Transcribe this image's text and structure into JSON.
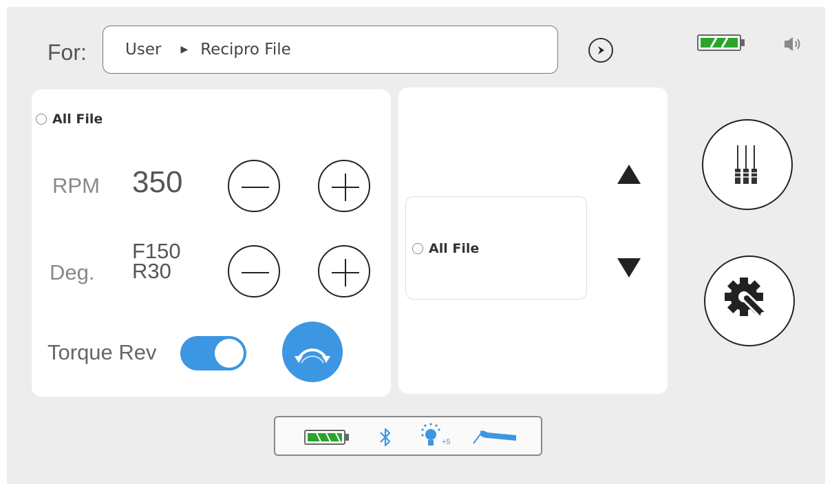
{
  "header": {
    "for_label": "For:",
    "breadcrumb": [
      "User",
      "Recipro File"
    ],
    "breadcrumb_separator": "▶"
  },
  "settings": {
    "file_option_label": "All File",
    "rpm": {
      "label": "RPM",
      "value": "350"
    },
    "degree": {
      "label": "Deg.",
      "forward": "F150",
      "reverse": "R30"
    },
    "torque_rev": {
      "label": "Torque Rev",
      "enabled": true
    }
  },
  "file_list": {
    "items": [
      {
        "label": "All File",
        "selected": false
      }
    ]
  },
  "status": {
    "light_level": "+5"
  },
  "colors": {
    "accent": "#3d96e2",
    "battery": "#2aa52a",
    "background": "#ededed"
  },
  "icons": [
    "forward-arrow-icon",
    "battery-icon",
    "speaker-icon",
    "minus-icon",
    "plus-icon",
    "rotation-icon",
    "arrow-up-icon",
    "arrow-down-icon",
    "files-icon",
    "settings-icon",
    "bluetooth-icon",
    "light-icon",
    "handpiece-icon"
  ]
}
